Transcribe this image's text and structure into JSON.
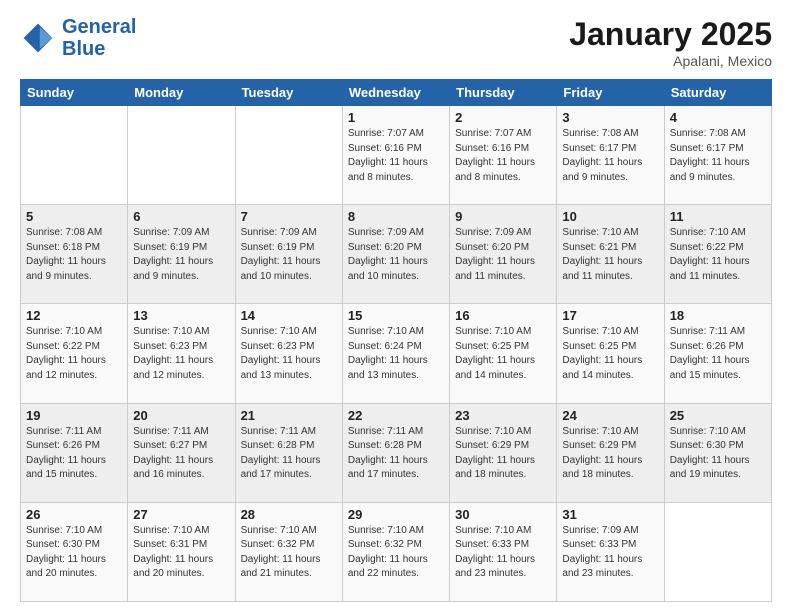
{
  "header": {
    "logo_line1": "General",
    "logo_line2": "Blue",
    "month": "January 2025",
    "location": "Apalani, Mexico"
  },
  "days_of_week": [
    "Sunday",
    "Monday",
    "Tuesday",
    "Wednesday",
    "Thursday",
    "Friday",
    "Saturday"
  ],
  "weeks": [
    [
      {
        "num": "",
        "info": ""
      },
      {
        "num": "",
        "info": ""
      },
      {
        "num": "",
        "info": ""
      },
      {
        "num": "1",
        "info": "Sunrise: 7:07 AM\nSunset: 6:16 PM\nDaylight: 11 hours\nand 8 minutes."
      },
      {
        "num": "2",
        "info": "Sunrise: 7:07 AM\nSunset: 6:16 PM\nDaylight: 11 hours\nand 8 minutes."
      },
      {
        "num": "3",
        "info": "Sunrise: 7:08 AM\nSunset: 6:17 PM\nDaylight: 11 hours\nand 9 minutes."
      },
      {
        "num": "4",
        "info": "Sunrise: 7:08 AM\nSunset: 6:17 PM\nDaylight: 11 hours\nand 9 minutes."
      }
    ],
    [
      {
        "num": "5",
        "info": "Sunrise: 7:08 AM\nSunset: 6:18 PM\nDaylight: 11 hours\nand 9 minutes."
      },
      {
        "num": "6",
        "info": "Sunrise: 7:09 AM\nSunset: 6:19 PM\nDaylight: 11 hours\nand 9 minutes."
      },
      {
        "num": "7",
        "info": "Sunrise: 7:09 AM\nSunset: 6:19 PM\nDaylight: 11 hours\nand 10 minutes."
      },
      {
        "num": "8",
        "info": "Sunrise: 7:09 AM\nSunset: 6:20 PM\nDaylight: 11 hours\nand 10 minutes."
      },
      {
        "num": "9",
        "info": "Sunrise: 7:09 AM\nSunset: 6:20 PM\nDaylight: 11 hours\nand 11 minutes."
      },
      {
        "num": "10",
        "info": "Sunrise: 7:10 AM\nSunset: 6:21 PM\nDaylight: 11 hours\nand 11 minutes."
      },
      {
        "num": "11",
        "info": "Sunrise: 7:10 AM\nSunset: 6:22 PM\nDaylight: 11 hours\nand 11 minutes."
      }
    ],
    [
      {
        "num": "12",
        "info": "Sunrise: 7:10 AM\nSunset: 6:22 PM\nDaylight: 11 hours\nand 12 minutes."
      },
      {
        "num": "13",
        "info": "Sunrise: 7:10 AM\nSunset: 6:23 PM\nDaylight: 11 hours\nand 12 minutes."
      },
      {
        "num": "14",
        "info": "Sunrise: 7:10 AM\nSunset: 6:23 PM\nDaylight: 11 hours\nand 13 minutes."
      },
      {
        "num": "15",
        "info": "Sunrise: 7:10 AM\nSunset: 6:24 PM\nDaylight: 11 hours\nand 13 minutes."
      },
      {
        "num": "16",
        "info": "Sunrise: 7:10 AM\nSunset: 6:25 PM\nDaylight: 11 hours\nand 14 minutes."
      },
      {
        "num": "17",
        "info": "Sunrise: 7:10 AM\nSunset: 6:25 PM\nDaylight: 11 hours\nand 14 minutes."
      },
      {
        "num": "18",
        "info": "Sunrise: 7:11 AM\nSunset: 6:26 PM\nDaylight: 11 hours\nand 15 minutes."
      }
    ],
    [
      {
        "num": "19",
        "info": "Sunrise: 7:11 AM\nSunset: 6:26 PM\nDaylight: 11 hours\nand 15 minutes."
      },
      {
        "num": "20",
        "info": "Sunrise: 7:11 AM\nSunset: 6:27 PM\nDaylight: 11 hours\nand 16 minutes."
      },
      {
        "num": "21",
        "info": "Sunrise: 7:11 AM\nSunset: 6:28 PM\nDaylight: 11 hours\nand 17 minutes."
      },
      {
        "num": "22",
        "info": "Sunrise: 7:11 AM\nSunset: 6:28 PM\nDaylight: 11 hours\nand 17 minutes."
      },
      {
        "num": "23",
        "info": "Sunrise: 7:10 AM\nSunset: 6:29 PM\nDaylight: 11 hours\nand 18 minutes."
      },
      {
        "num": "24",
        "info": "Sunrise: 7:10 AM\nSunset: 6:29 PM\nDaylight: 11 hours\nand 18 minutes."
      },
      {
        "num": "25",
        "info": "Sunrise: 7:10 AM\nSunset: 6:30 PM\nDaylight: 11 hours\nand 19 minutes."
      }
    ],
    [
      {
        "num": "26",
        "info": "Sunrise: 7:10 AM\nSunset: 6:30 PM\nDaylight: 11 hours\nand 20 minutes."
      },
      {
        "num": "27",
        "info": "Sunrise: 7:10 AM\nSunset: 6:31 PM\nDaylight: 11 hours\nand 20 minutes."
      },
      {
        "num": "28",
        "info": "Sunrise: 7:10 AM\nSunset: 6:32 PM\nDaylight: 11 hours\nand 21 minutes."
      },
      {
        "num": "29",
        "info": "Sunrise: 7:10 AM\nSunset: 6:32 PM\nDaylight: 11 hours\nand 22 minutes."
      },
      {
        "num": "30",
        "info": "Sunrise: 7:10 AM\nSunset: 6:33 PM\nDaylight: 11 hours\nand 23 minutes."
      },
      {
        "num": "31",
        "info": "Sunrise: 7:09 AM\nSunset: 6:33 PM\nDaylight: 11 hours\nand 23 minutes."
      },
      {
        "num": "",
        "info": ""
      }
    ]
  ]
}
